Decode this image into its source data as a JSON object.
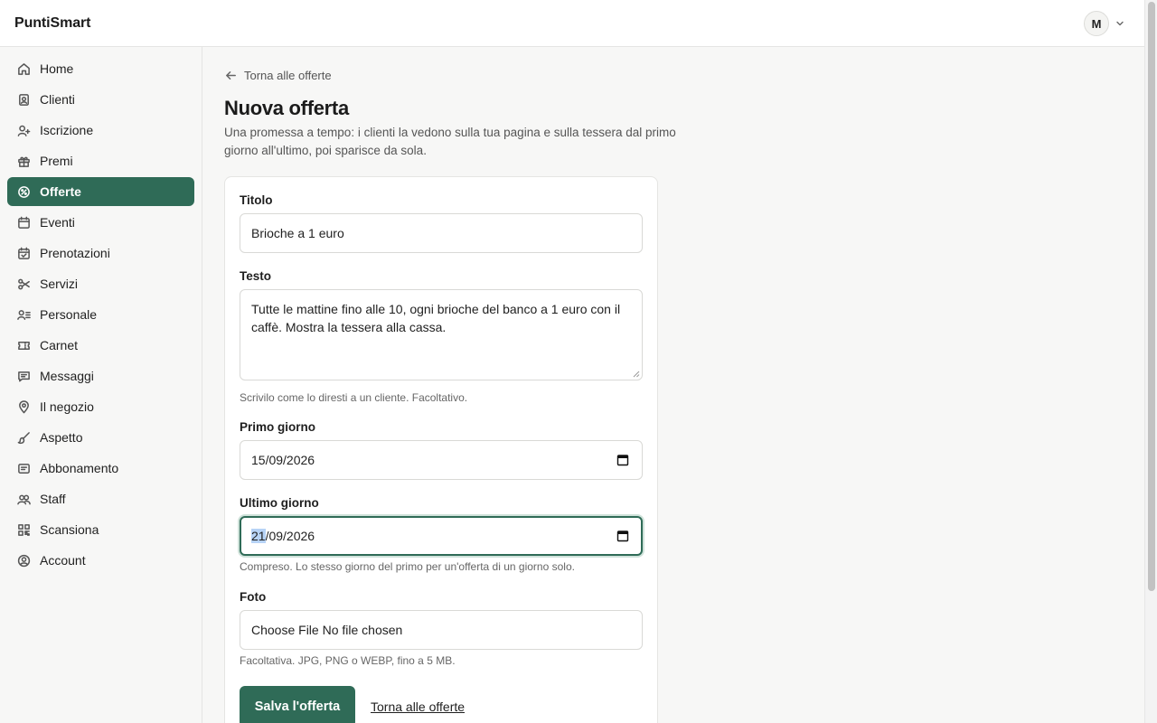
{
  "app": {
    "brand": "PuntiSmart",
    "avatar_initial": "M"
  },
  "sidebar": {
    "items": [
      {
        "label": "Home",
        "icon": "home-icon"
      },
      {
        "label": "Clienti",
        "icon": "contacts-icon"
      },
      {
        "label": "Iscrizione",
        "icon": "user-plus-icon"
      },
      {
        "label": "Premi",
        "icon": "gift-icon"
      },
      {
        "label": "Offerte",
        "icon": "badge-percent-icon",
        "active": true
      },
      {
        "label": "Eventi",
        "icon": "calendar-icon"
      },
      {
        "label": "Prenotazioni",
        "icon": "calendar-check-icon"
      },
      {
        "label": "Servizi",
        "icon": "scissors-icon"
      },
      {
        "label": "Personale",
        "icon": "user-list-icon"
      },
      {
        "label": "Carnet",
        "icon": "ticket-icon"
      },
      {
        "label": "Messaggi",
        "icon": "message-icon"
      },
      {
        "label": "Il negozio",
        "icon": "map-pin-icon"
      },
      {
        "label": "Aspetto",
        "icon": "brush-icon"
      },
      {
        "label": "Abbonamento",
        "icon": "receipt-icon"
      },
      {
        "label": "Staff",
        "icon": "users-icon"
      },
      {
        "label": "Scansiona",
        "icon": "qr-code-icon"
      },
      {
        "label": "Account",
        "icon": "user-circle-icon"
      }
    ]
  },
  "main": {
    "back_label": "Torna alle offerte",
    "title": "Nuova offerta",
    "description": "Una promessa a tempo: i clienti la vedono sulla tua pagina e sulla tessera dal primo giorno all'ultimo, poi sparisce da sola."
  },
  "form": {
    "title_label": "Titolo",
    "title_value": "Brioche a 1 euro",
    "text_label": "Testo",
    "text_value": "Tutte le mattine fino alle 10, ogni brioche del banco a 1 euro con il caffè. Mostra la tessera alla cassa.",
    "text_hint": "Scrivilo come lo diresti a un cliente. Facoltativo.",
    "start_label": "Primo giorno",
    "start_value": "15/09/2026",
    "end_label": "Ultimo giorno",
    "end_value_day": "21",
    "end_value_rest": "/09/2026",
    "end_hint": "Compreso. Lo stesso giorno del primo per un'offerta di un giorno solo.",
    "photo_label": "Foto",
    "photo_value": "Choose File No file chosen",
    "photo_hint": "Facoltativa. JPG, PNG o WEBP, fino a 5 MB.",
    "save_label": "Salva l'offerta",
    "cancel_label": "Torna alle offerte"
  },
  "colors": {
    "accent": "#2f6b57",
    "selection": "#b7d3f6"
  }
}
